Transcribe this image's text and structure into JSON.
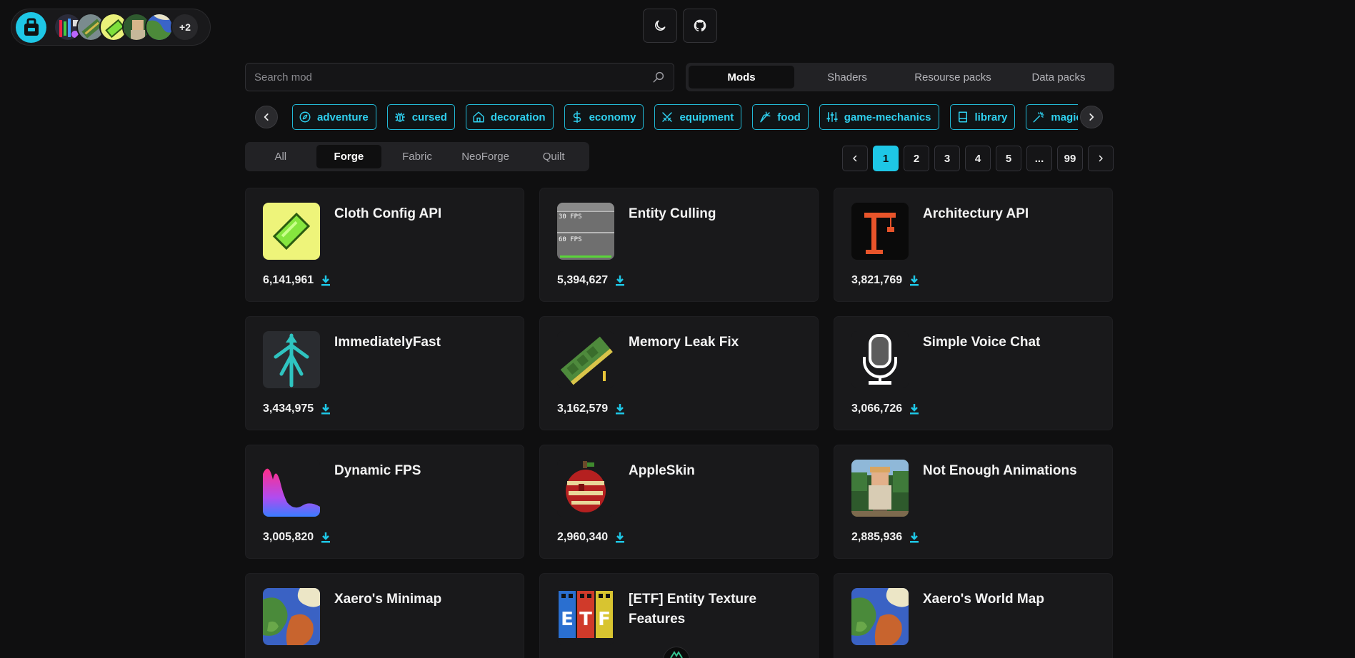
{
  "avatars_more": "+2",
  "search": {
    "placeholder": "Search mod"
  },
  "type_tabs": [
    {
      "label": "Mods",
      "active": true
    },
    {
      "label": "Shaders",
      "active": false
    },
    {
      "label": "Resourse packs",
      "active": false
    },
    {
      "label": "Data packs",
      "active": false
    }
  ],
  "categories": [
    {
      "label": "adventure",
      "icon": "compass-icon"
    },
    {
      "label": "cursed",
      "icon": "bug-icon"
    },
    {
      "label": "decoration",
      "icon": "house-icon"
    },
    {
      "label": "economy",
      "icon": "dollar-icon"
    },
    {
      "label": "equipment",
      "icon": "swords-icon"
    },
    {
      "label": "food",
      "icon": "carrot-icon"
    },
    {
      "label": "game-mechanics",
      "icon": "sliders-icon"
    },
    {
      "label": "library",
      "icon": "book-icon"
    },
    {
      "label": "magic",
      "icon": "wand-icon"
    }
  ],
  "loader_tabs": [
    {
      "label": "All",
      "active": false
    },
    {
      "label": "Forge",
      "active": true
    },
    {
      "label": "Fabric",
      "active": false
    },
    {
      "label": "NeoForge",
      "active": false
    },
    {
      "label": "Quilt",
      "active": false
    }
  ],
  "pagination": [
    "1",
    "2",
    "3",
    "4",
    "5",
    "...",
    "99"
  ],
  "accent_color": "#1ec7e6",
  "mods": [
    {
      "title": "Cloth Config API",
      "downloads": "6,141,961"
    },
    {
      "title": "Entity Culling",
      "downloads": "5,394,627"
    },
    {
      "title": "Architectury API",
      "downloads": "3,821,769"
    },
    {
      "title": "ImmediatelyFast",
      "downloads": "3,434,975"
    },
    {
      "title": "Memory Leak Fix",
      "downloads": "3,162,579"
    },
    {
      "title": "Simple Voice Chat",
      "downloads": "3,066,726"
    },
    {
      "title": "Dynamic FPS",
      "downloads": "3,005,820"
    },
    {
      "title": "AppleSkin",
      "downloads": "2,960,340"
    },
    {
      "title": "Not Enough Animations",
      "downloads": "2,885,936"
    },
    {
      "title": "Xaero's Minimap",
      "downloads": ""
    },
    {
      "title": "[ETF] Entity Texture Features",
      "downloads": ""
    },
    {
      "title": "Xaero's World Map",
      "downloads": ""
    }
  ]
}
